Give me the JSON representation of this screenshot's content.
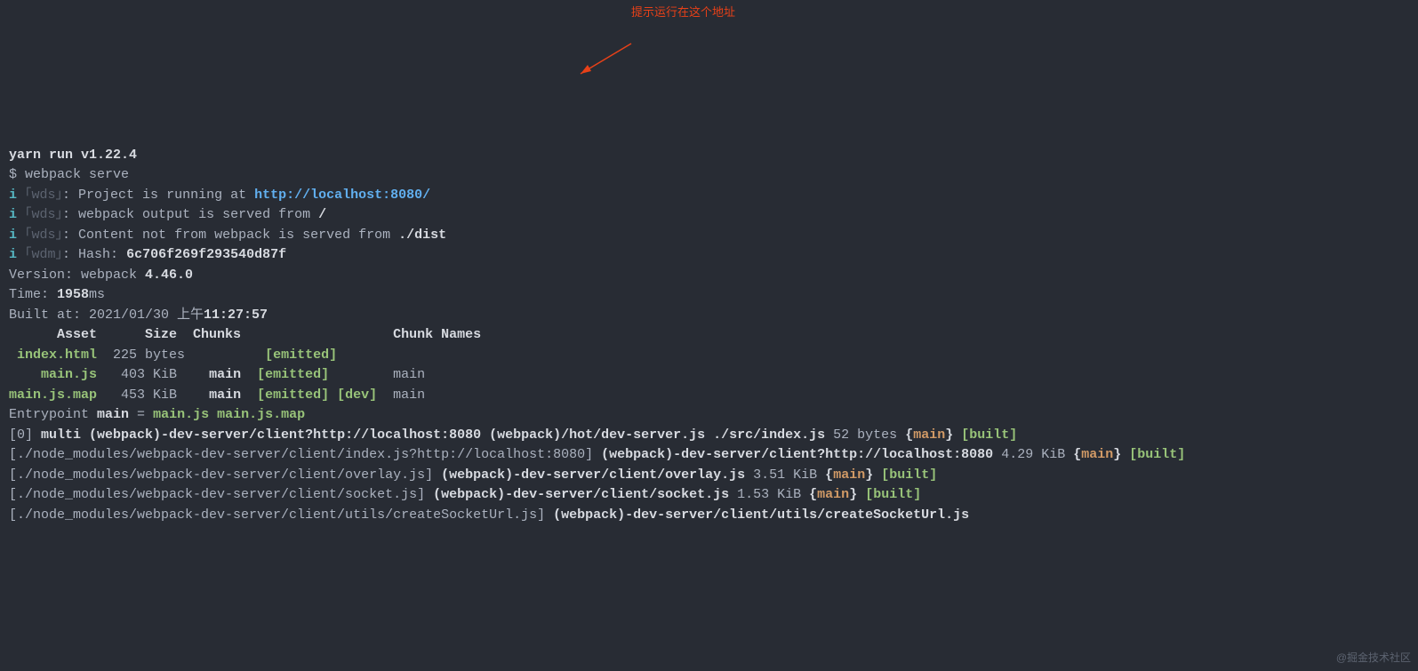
{
  "header": {
    "yarn_line": "yarn run v1.22.4",
    "prompt": "$ ",
    "command": "webpack serve"
  },
  "annotation": {
    "text": "提示运行在这个地址"
  },
  "wds": {
    "i": "i",
    "tag": " ｢wds｣",
    "wdm_tag": " ｢wdm｣",
    "colon": ": ",
    "line1_pre": "Project is running at ",
    "line1_url": "http://localhost:8080/",
    "line2_pre": "webpack output is served from ",
    "line2_path": "/",
    "line3_pre": "Content not from webpack is served from ",
    "line3_path": "./dist",
    "line4_pre": "Hash: ",
    "line4_hash": "6c706f269f293540d87f"
  },
  "info": {
    "version_label": "Version: webpack ",
    "version_val": "4.46.0",
    "time_label": "Time: ",
    "time_val": "1958",
    "time_unit": "ms",
    "built_label": "Built at: 2021/01/30 上午",
    "built_time": "11:27:57"
  },
  "table": {
    "header": "      Asset      Size  Chunks                   Chunk Names",
    "r1_asset": " index.html",
    "r1_rest": "  225 bytes          ",
    "r1_emit": "[emitted]",
    "r2_asset": "    main.js",
    "r2_rest": "   403 KiB    ",
    "r2_chunk": "main",
    "r2_emit": "  [emitted]",
    "r2_name": "        main",
    "r3_asset": "main.js.map",
    "r3_rest": "   453 KiB    ",
    "r3_chunk": "main",
    "r3_emit": "  [emitted] [dev]",
    "r3_name": "  main"
  },
  "entry": {
    "label": "Entrypoint ",
    "name": "main",
    "eq": " = ",
    "files": "main.js main.js.map"
  },
  "modules": {
    "m0_idx": "[0] ",
    "m0_name": "multi (webpack)-dev-server/client?http://localhost:8080 (webpack)/hot/dev-server.js ./src/index.js",
    "m0_size": " 52 bytes ",
    "m0_chunk": "{",
    "m0_chunk_name": "main",
    "m0_chunk_end": "}",
    "m0_built": " [built]",
    "m1_path": "[./node_modules/webpack-dev-server/client/index.js?http://localhost:8080] ",
    "m1_name": "(webpack)-dev-server/client?http://localhost:8080",
    "m1_size": " 4.29 KiB ",
    "m2_path": "[./node_modules/webpack-dev-server/client/overlay.js] ",
    "m2_name": "(webpack)-dev-server/client/overlay.js",
    "m2_size": " 3.51 KiB ",
    "m3_path": "[./node_modules/webpack-dev-server/client/socket.js] ",
    "m3_name": "(webpack)-dev-server/client/socket.js",
    "m3_size": " 1.53 KiB ",
    "m4_path": "[./node_modules/webpack-dev-server/client/utils/createSocketUrl.js] ",
    "m4_name": "(webpack)-dev-server/client/utils/createSocketUrl.js"
  },
  "watermark": "@掘金技术社区"
}
